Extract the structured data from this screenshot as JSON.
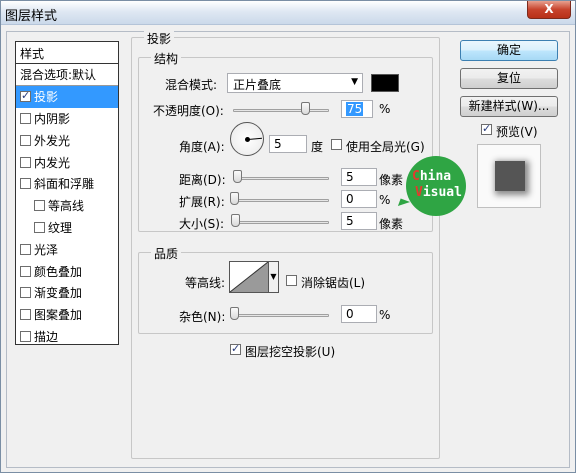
{
  "window": {
    "title": "图层样式",
    "close_label": "X"
  },
  "styles": {
    "header": "样式",
    "items": [
      {
        "label": "混合选项:默认",
        "checkbox": false
      },
      {
        "label": "投影",
        "checkbox": true,
        "checked": true,
        "selected": true
      },
      {
        "label": "内阴影",
        "checkbox": true,
        "checked": false
      },
      {
        "label": "外发光",
        "checkbox": true,
        "checked": false
      },
      {
        "label": "内发光",
        "checkbox": true,
        "checked": false
      },
      {
        "label": "斜面和浮雕",
        "checkbox": true,
        "checked": false
      },
      {
        "label": "等高线",
        "checkbox": true,
        "checked": false,
        "sub": true
      },
      {
        "label": "纹理",
        "checkbox": true,
        "checked": false,
        "sub": true
      },
      {
        "label": "光泽",
        "checkbox": true,
        "checked": false
      },
      {
        "label": "颜色叠加",
        "checkbox": true,
        "checked": false
      },
      {
        "label": "渐变叠加",
        "checkbox": true,
        "checked": false
      },
      {
        "label": "图案叠加",
        "checkbox": true,
        "checked": false
      },
      {
        "label": "描边",
        "checkbox": true,
        "checked": false
      }
    ]
  },
  "drop_shadow": {
    "group_title": "投影",
    "structure": {
      "title": "结构",
      "blend_mode_label": "混合模式:",
      "blend_mode_value": "正片叠底",
      "blend_color": "#000000",
      "opacity_label": "不透明度(O):",
      "opacity_value": "75",
      "opacity_unit": "%",
      "opacity_fraction": 0.75,
      "angle_label": "角度(A):",
      "angle_value": "5",
      "angle_unit": "度",
      "angle_degrees": 5,
      "global_light_label": "使用全局光(G)",
      "global_light_checked": false,
      "distance_label": "距离(D):",
      "distance_value": "5",
      "distance_unit": "像素",
      "spread_label": "扩展(R):",
      "spread_value": "0",
      "spread_unit": "%",
      "size_label": "大小(S):",
      "size_value": "5",
      "size_unit": "像素"
    },
    "quality": {
      "title": "品质",
      "contour_label": "等高线:",
      "antialias_label": "消除锯齿(L)",
      "antialias_checked": false,
      "noise_label": "杂色(N):",
      "noise_value": "0",
      "noise_unit": "%"
    },
    "knockout_label": "图层挖空投影(U)",
    "knockout_checked": true
  },
  "buttons": {
    "ok": "确定",
    "reset": "复位",
    "new_style": "新建样式(W)...",
    "preview_label": "预览(V)",
    "preview_checked": true
  },
  "watermark": {
    "line1": "China",
    "line2": "Visual",
    "color": "#2fa544"
  }
}
